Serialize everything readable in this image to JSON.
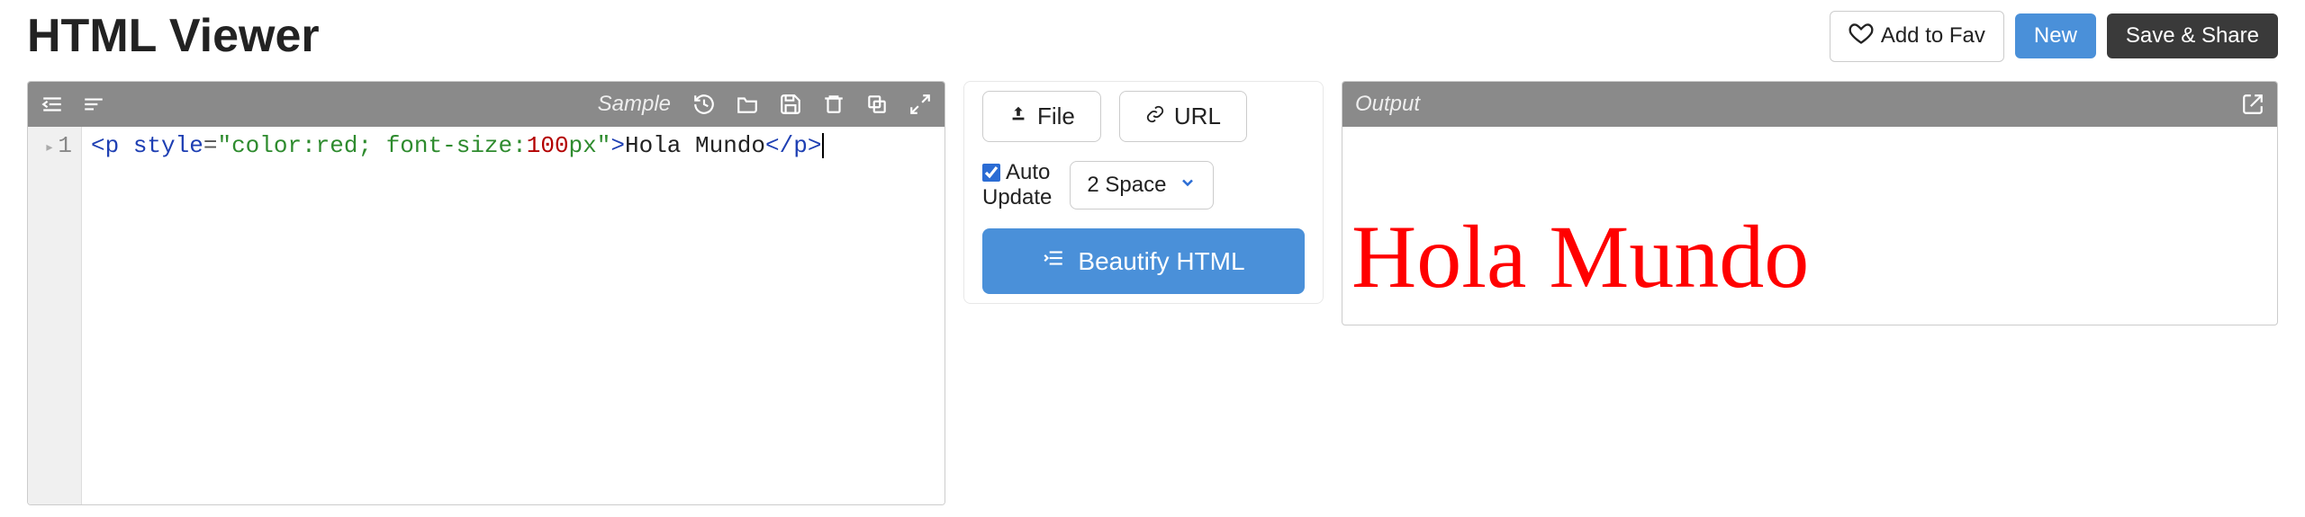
{
  "header": {
    "title": "HTML Viewer",
    "add_fav": "Add to Fav",
    "new": "New",
    "save_share": "Save & Share"
  },
  "editor": {
    "sample_label": "Sample",
    "line_number": "1",
    "code": {
      "open_tag": "<p",
      "attr_name": " style",
      "eq": "=",
      "q1": "\"",
      "prop1": "color:red;",
      "space1": " ",
      "prop2": "font-size:",
      "num": "100",
      "unit": "px",
      "q2": "\"",
      "gt": ">",
      "text": "Hola Mundo",
      "close_tag": "</p>"
    }
  },
  "middle": {
    "file_btn": "File",
    "url_btn": "URL",
    "auto_update_label1": "Auto",
    "auto_update_label2": "Update",
    "auto_update_checked": true,
    "indent_select": "2 Space",
    "beautify": "Beautify HTML"
  },
  "output": {
    "label": "Output",
    "rendered": "Hola Mundo"
  }
}
